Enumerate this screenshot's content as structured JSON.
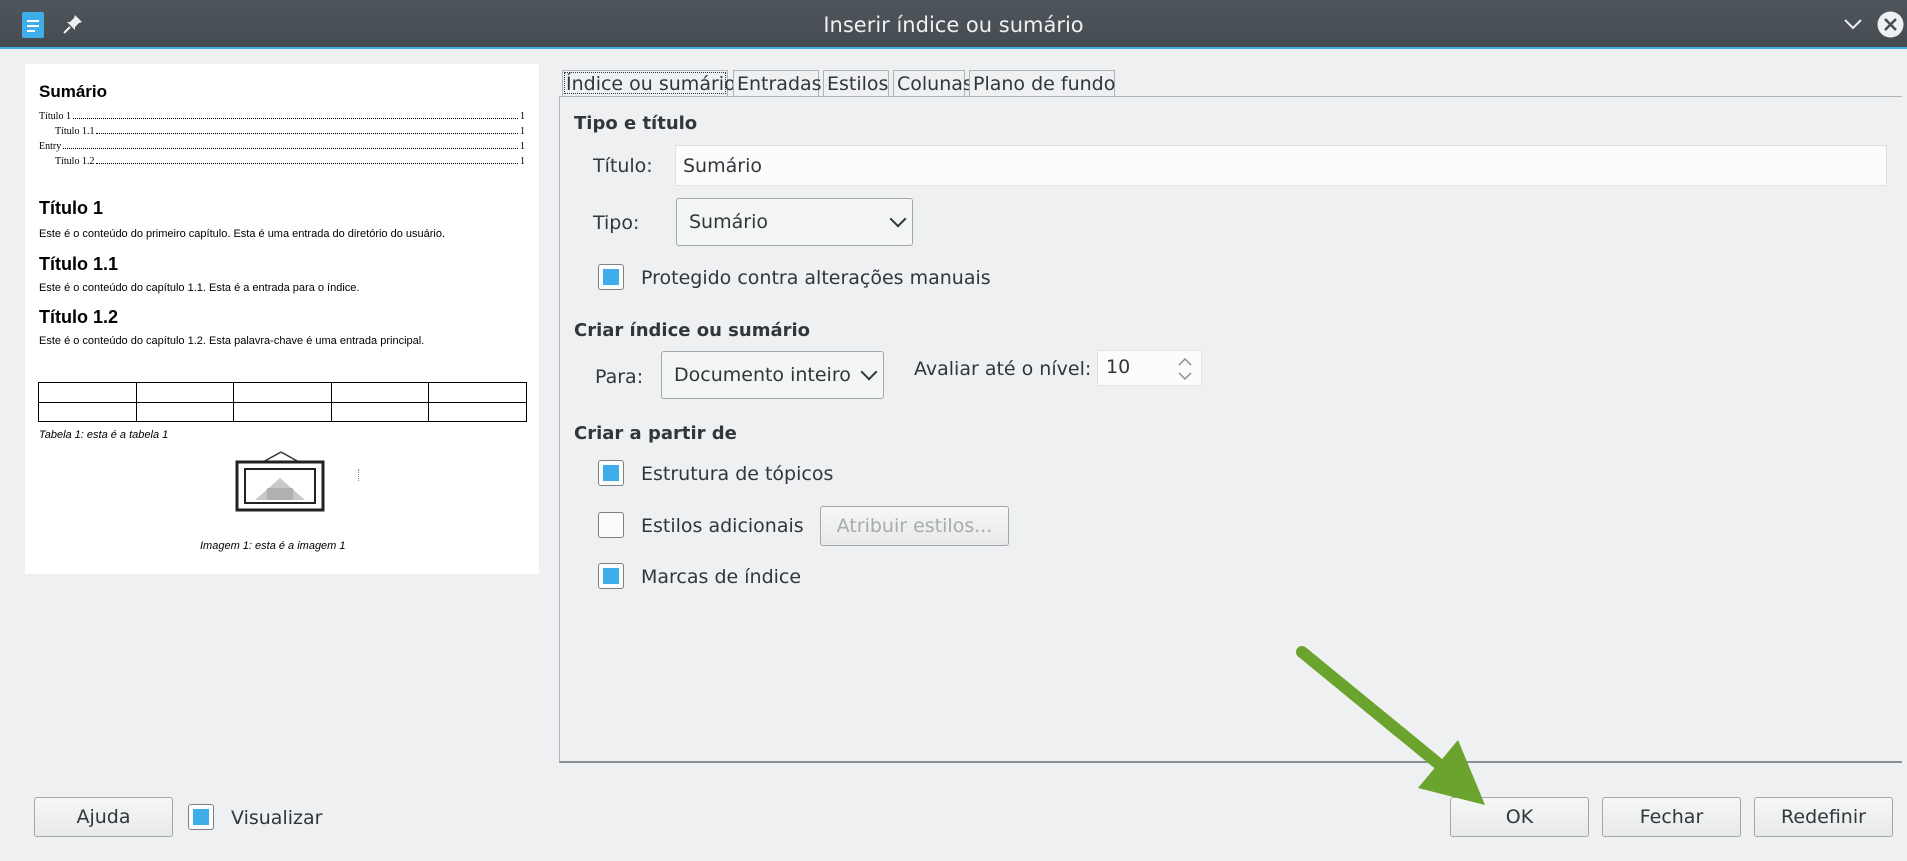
{
  "window": {
    "title": "Inserir índice ou sumário"
  },
  "preview": {
    "toc_title": "Sumário",
    "toc_entries": [
      {
        "text": "Título 1",
        "page": "1"
      },
      {
        "text": "Título 1.1",
        "page": "1"
      },
      {
        "text": "Entry",
        "page": "1"
      },
      {
        "text": "Título 1.2",
        "page": "1"
      }
    ],
    "heading1": "Título 1",
    "para1": "Este é o conteúdo do primeiro capítulo. Esta é uma entrada do diretório do usuário.",
    "heading2": "Título 1.1",
    "para2": "Este é o conteúdo do capítulo 1.1. Esta é a entrada para o índice.",
    "heading3": "Título 1.2",
    "para3": "Este é o conteúdo do capítulo 1.2. Esta palavra-chave é uma entrada principal.",
    "table_caption": "Tabela 1: esta é a tabela 1",
    "image_caption": "Imagem 1: esta é a imagem 1"
  },
  "tabs": [
    {
      "label": "Índice ou sumário",
      "active": true
    },
    {
      "label": "Entradas"
    },
    {
      "label": "Estilos"
    },
    {
      "label": "Colunas"
    },
    {
      "label": "Plano de fundo"
    }
  ],
  "type_title": {
    "section": "Tipo e título",
    "title_label": "Título:",
    "title_value": "Sumário",
    "type_label": "Tipo:",
    "type_value": "Sumário",
    "protect_label": "Protegido contra alterações manuais",
    "protect_checked": true
  },
  "create_index": {
    "section": "Criar índice ou sumário",
    "for_label": "Para:",
    "for_value": "Documento inteiro",
    "level_label": "Avaliar até o nível:",
    "level_value": "10"
  },
  "create_from": {
    "section": "Criar a partir de",
    "outline_label": "Estrutura de tópicos",
    "outline_checked": true,
    "additional_label": "Estilos adicionais",
    "additional_checked": false,
    "assign_styles_button": "Atribuir estilos...",
    "index_marks_label": "Marcas de índice",
    "index_marks_checked": true
  },
  "footer": {
    "help_button": "Ajuda",
    "preview_label": "Visualizar",
    "preview_checked": true,
    "ok_button": "OK",
    "close_button": "Fechar",
    "reset_button": "Redefinir"
  },
  "colors": {
    "accent": "#3daee9",
    "annotation_arrow": "#6aa32d"
  }
}
